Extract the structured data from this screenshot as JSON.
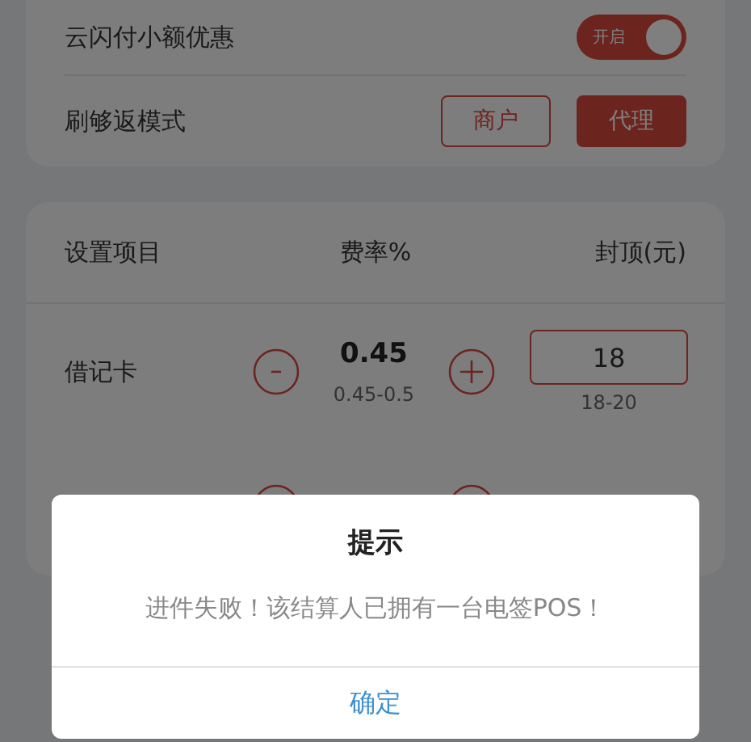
{
  "settings": [
    {
      "kind": "toggle",
      "label": "云闪付小额优惠",
      "toggle": {
        "label": "开启",
        "on": true
      }
    },
    {
      "kind": "choice",
      "label": "刷够返模式",
      "options": [
        {
          "label": "商户",
          "selected": false
        },
        {
          "label": "代理",
          "selected": true
        }
      ]
    }
  ],
  "table": {
    "columns": [
      "设置项目",
      "费率%",
      "封顶(元)"
    ],
    "rows": [
      {
        "name": "借记卡",
        "rate": "0.45",
        "rate_range": "0.45-0.5",
        "cap": "18",
        "cap_range": "18-20"
      }
    ]
  },
  "dialog": {
    "title": "提示",
    "message": "进件失败！该结算人已拥有一台电签POS！",
    "button": "确定"
  }
}
